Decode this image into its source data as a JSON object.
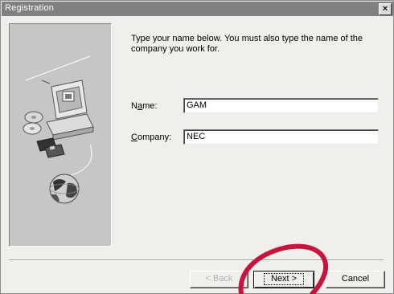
{
  "window": {
    "title": "Registration",
    "close_glyph": "×",
    "titlebar_color": "#808080"
  },
  "instructions": "Type your name below. You must also type the name of the company you work for.",
  "form": {
    "name_label_pre": "N",
    "name_label_mnemonic": "a",
    "name_label_post": "me:",
    "name_value": "GAM",
    "company_label_mnemonic": "C",
    "company_label_post": "ompany:",
    "company_value": "NEC"
  },
  "buttons": {
    "back_label": "< Back",
    "next_label": "Next >",
    "cancel_label": "Cancel"
  },
  "illustration": {
    "icons": [
      "computer-icon",
      "cd-disc-icon",
      "floppy-disk-icon",
      "globe-icon"
    ]
  },
  "annotation": {
    "color": "#c8143c"
  }
}
